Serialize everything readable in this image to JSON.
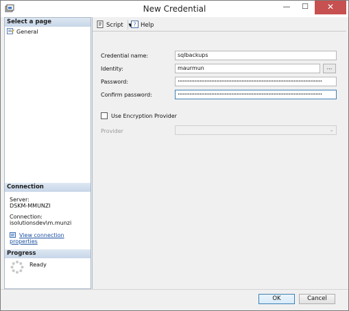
{
  "window": {
    "title": "New Credential"
  },
  "left": {
    "select_page_header": "Select a page",
    "pages": [
      {
        "label": "General",
        "icon": "page-icon"
      }
    ],
    "connection_header": "Connection",
    "server_label": "Server:",
    "server_value": "DSKM-MMUNZI",
    "connection_label": "Connection:",
    "connection_value": "isolutionsdev\\m.munzi",
    "view_connection_link": "View connection properties",
    "progress_header": "Progress",
    "progress_status": "Ready"
  },
  "toolbar": {
    "script_label": "Script",
    "help_label": "Help"
  },
  "form": {
    "credential_name_label": "Credential name:",
    "credential_name_value": "sqlbackups",
    "identity_label": "Identity:",
    "identity_value": "maurmun",
    "browse_label": "...",
    "password_label": "Password:",
    "password_value": "••••••••••••••••••••••••••••••••••••••••••••••••••••••••••••••••••••••••••••••••••••••",
    "confirm_password_label": "Confirm password:",
    "confirm_password_value": "••••••••••••••••••••••••••••••••••••••••••••••••••••••••••••••••••••••••••••••••••••••",
    "use_encryption_label": "Use Encryption Provider",
    "use_encryption_checked": false,
    "provider_label": "Provider",
    "provider_value": ""
  },
  "buttons": {
    "ok": "OK",
    "cancel": "Cancel"
  },
  "colors": {
    "link": "#1a4fa0",
    "close_button": "#c75050",
    "section_header": "#c7d6e8"
  }
}
